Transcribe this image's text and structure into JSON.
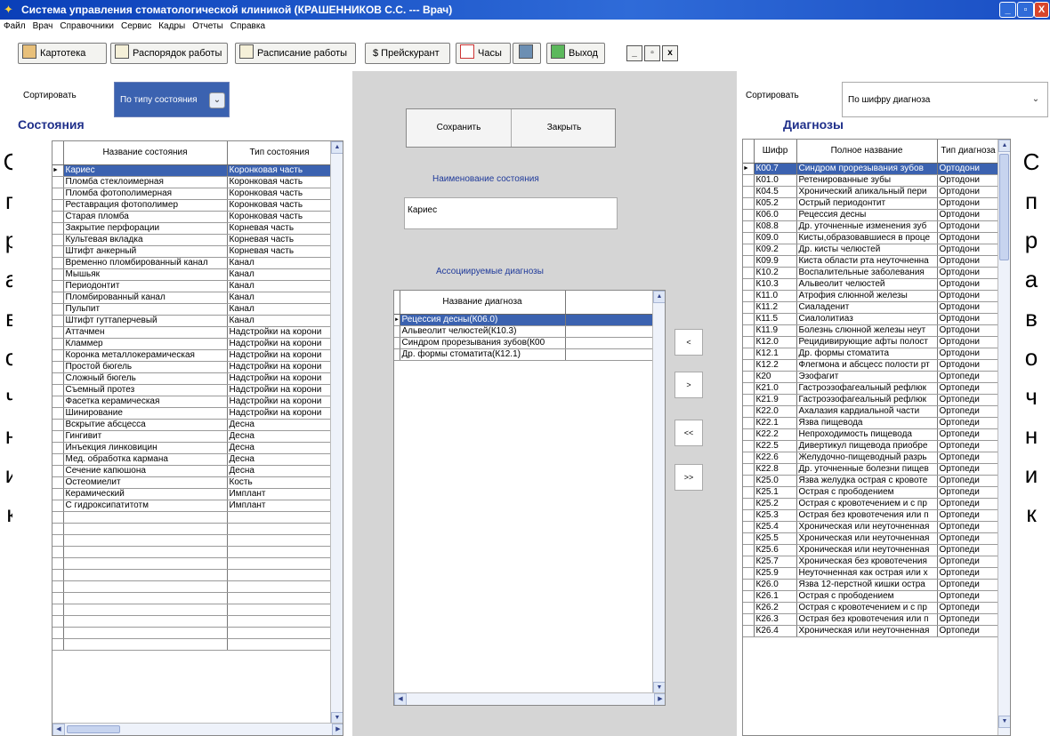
{
  "window": {
    "title": "Система управления стоматологической клиникой (КРАШЕННИКОВ С.С. --- Врач)",
    "minimize": "_",
    "maximize": "▫",
    "close": "X"
  },
  "menu": [
    "Файл",
    "Врач",
    "Справочники",
    "Сервис",
    "Кадры",
    "Отчеты",
    "Справка"
  ],
  "toolbar": {
    "kartoteka": "Картотека",
    "rasporyadok": "Распорядок работы",
    "raspisanie": "Расписание работы",
    "preiskurant": "$ Прейскурант",
    "chasy": "Часы",
    "vyhod": "Выход",
    "mini_min": "_",
    "mini_max": "▫",
    "mini_close": "x"
  },
  "side_word": [
    "С",
    "п",
    "р",
    "а",
    "в",
    "о",
    "ч",
    "н",
    "и",
    "к"
  ],
  "left": {
    "sort_label": "Сортировать",
    "sort_value": "По типу состояния",
    "title": "Состояния",
    "columns": [
      "Название состояния",
      "Тип состояния"
    ],
    "rows": [
      [
        "Кариес",
        "Коронковая часть"
      ],
      [
        "Пломба стеклоимерная",
        "Коронковая часть"
      ],
      [
        "Пломба фотополимерная",
        "Коронковая часть"
      ],
      [
        "Реставрация фотополимер",
        "Коронковая часть"
      ],
      [
        "Старая пломба",
        "Коронковая часть"
      ],
      [
        "Закрытие перфорации",
        "Корневая часть"
      ],
      [
        "Культевая вкладка",
        "Корневая часть"
      ],
      [
        "Штифт анкерный",
        "Корневая часть"
      ],
      [
        "Временно пломбированный канал",
        "Канал"
      ],
      [
        "Мышьяк",
        "Канал"
      ],
      [
        "Периодонтит",
        "Канал"
      ],
      [
        "Пломбированный канал",
        "Канал"
      ],
      [
        "Пульпит",
        "Канал"
      ],
      [
        "Штифт гуттаперчевый",
        "Канал"
      ],
      [
        "Аттачмен",
        "Надстройки на корони"
      ],
      [
        "Кламмер",
        "Надстройки на корони"
      ],
      [
        "Коронка металлокерамическая",
        "Надстройки на корони"
      ],
      [
        "Простой бюгель",
        "Надстройки на корони"
      ],
      [
        "Сложный бюгель",
        "Надстройки на корони"
      ],
      [
        "Съемный протез",
        "Надстройки на корони"
      ],
      [
        "Фасетка керамическая",
        "Надстройки на корони"
      ],
      [
        "Шинирование",
        "Надстройки на корони"
      ],
      [
        "Вскрытие абсцесса",
        "Десна"
      ],
      [
        "Гингивит",
        "Десна"
      ],
      [
        "Инъекция линковицин",
        "Десна"
      ],
      [
        "Мед. обработка кармана",
        "Десна"
      ],
      [
        "Сечение капюшона",
        "Десна"
      ],
      [
        "Остеомиелит",
        "Кость"
      ],
      [
        "Керамический",
        "Имплант"
      ],
      [
        "С гидроксипатитотм",
        "Имплант"
      ]
    ]
  },
  "center": {
    "save": "Сохранить",
    "close": "Закрыть",
    "name_label": "Наименование состояния",
    "name_value": "Кариес",
    "assoc_label": "Ассоциируемые диагнозы",
    "assoc_column": "Название диагноза",
    "assoc_rows": [
      "Рецессия десны(К06.0)",
      "Альвеолит челюстей(К10.3)",
      "Синдром прорезывания зубов(К00",
      "Др. формы стоматита(К12.1)"
    ],
    "btn_one_left": "<",
    "btn_one_right": ">",
    "btn_all_left": "<<",
    "btn_all_right": ">>"
  },
  "right": {
    "sort_label": "Сортировать",
    "sort_value": "По шифру диагноза",
    "title": "Диагнозы",
    "columns": [
      "Шифр",
      "Полное название",
      "Тип диагноза"
    ],
    "rows": [
      [
        "К00.7",
        "Синдром прорезывания зубов",
        "Ортодони"
      ],
      [
        "К01.0",
        "Ретенированные зубы",
        "Ортодони"
      ],
      [
        "К04.5",
        "Хронический апикальный пери",
        "Ортодони"
      ],
      [
        "К05.2",
        "Острый периодонтит",
        "Ортодони"
      ],
      [
        "К06.0",
        "Рецессия десны",
        "Ортодони"
      ],
      [
        "К08.8",
        "Др. уточненные изменения зуб",
        "Ортодони"
      ],
      [
        "К09.0",
        "Кисты,образовавшиеся в проце",
        "Ортодони"
      ],
      [
        "К09.2",
        "Др. кисты челюстей",
        "Ортодони"
      ],
      [
        "К09.9",
        "Киста области рта неуточненна",
        "Ортодони"
      ],
      [
        "К10.2",
        "Воспалительные заболевания",
        "Ортодони"
      ],
      [
        "К10.3",
        "Альвеолит челюстей",
        "Ортодони"
      ],
      [
        "К11.0",
        "Атрофия слюнной железы",
        "Ортодони"
      ],
      [
        "К11.2",
        "Сиаладенит",
        "Ортодони"
      ],
      [
        "К11.5",
        "Сиалолитиаз",
        "Ортодони"
      ],
      [
        "К11.9",
        "Болезнь слюнной железы неут",
        "Ортодони"
      ],
      [
        "К12.0",
        "Рецидивирующие афты полост",
        "Ортодони"
      ],
      [
        "К12.1",
        "Др. формы стоматита",
        "Ортодони"
      ],
      [
        "К12.2",
        "Флегмона и абсцесс полости рт",
        "Ортодони"
      ],
      [
        "К20",
        "Эзофагит",
        "Ортопеди"
      ],
      [
        "К21.0",
        "Гастроэзофагеальный рефлюк",
        "Ортопеди"
      ],
      [
        "К21.9",
        "Гастроэзофагеальный рефлюк",
        "Ортопеди"
      ],
      [
        "К22.0",
        "Ахалазия кардиальной части",
        "Ортопеди"
      ],
      [
        "К22.1",
        "Язва пищевода",
        "Ортопеди"
      ],
      [
        "К22.2",
        "Непроходимость пищевода",
        "Ортопеди"
      ],
      [
        "К22.5",
        "Дивертикул пищевода приобре",
        "Ортопеди"
      ],
      [
        "К22.6",
        "Желудочно-пищеводный разрь",
        "Ортопеди"
      ],
      [
        "К22.8",
        "Др. уточненные болезни пищев",
        "Ортопеди"
      ],
      [
        "К25.0",
        "Язва желудка острая с кровоте",
        "Ортопеди"
      ],
      [
        "К25.1",
        "Острая с прободением",
        "Ортопеди"
      ],
      [
        "К25.2",
        "Острая с кровотечением и с пр",
        "Ортопеди"
      ],
      [
        "К25.3",
        "Острая без кровотечения или п",
        "Ортопеди"
      ],
      [
        "К25.4",
        "Хроническая или неуточненная",
        "Ортопеди"
      ],
      [
        "К25.5",
        "Хроническая или неуточненная",
        "Ортопеди"
      ],
      [
        "К25.6",
        "Хроническая или неуточненная",
        "Ортопеди"
      ],
      [
        "К25.7",
        "Хроническая без кровотечения",
        "Ортопеди"
      ],
      [
        "К25.9",
        "Неуточненная как острая или х",
        "Ортопеди"
      ],
      [
        "К26.0",
        "Язва 12-перстной кишки остра",
        "Ортопеди"
      ],
      [
        "К26.1",
        "Острая с прободением",
        "Ортопеди"
      ],
      [
        "К26.2",
        "Острая с кровотечением и с пр",
        "Ортопеди"
      ],
      [
        "К26.3",
        "Острая без кровотечения или п",
        "Ортопеди"
      ],
      [
        "К26.4",
        "Хроническая или неуточненная",
        "Ортопеди"
      ]
    ]
  }
}
